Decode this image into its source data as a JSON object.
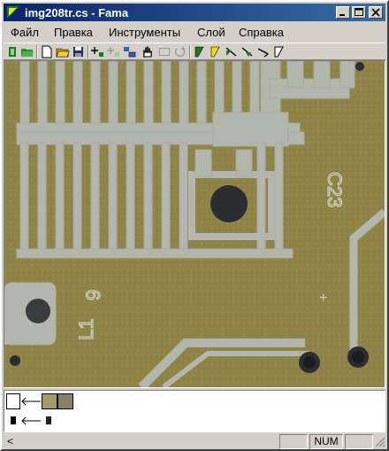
{
  "window": {
    "title": "img208tr.cs - Fama",
    "app_icon": "fama-app-icon",
    "controls": [
      "minimize-icon",
      "maximize-icon",
      "close-icon"
    ]
  },
  "menu": {
    "items": [
      {
        "label": "Файл"
      },
      {
        "label": "Правка"
      },
      {
        "label": "Инструменты"
      },
      {
        "label": "Слой"
      },
      {
        "label": "Справка"
      }
    ]
  },
  "toolbar": {
    "tools": [
      "open-layer-icon",
      "open-folder-icon",
      "new-document-icon",
      "open-file-icon",
      "save-icon",
      "add-point-icon",
      "remove-point-icon",
      "select-region-icon",
      "hand-pan-icon",
      "rect-select-icon",
      "rotate-icon",
      "layer-green-icon",
      "layer-yellow-icon",
      "layer-green-arrow-icon",
      "layer-arrow-down-icon",
      "layer-arrow-right-icon",
      "layer-outline-icon"
    ]
  },
  "canvas": {
    "image_name": "img208tr.cs",
    "silkscreen_labels": {
      "c23": "C23",
      "nine": "9",
      "l1": "L1",
      "plus": "+"
    },
    "colors": {
      "board": "#8f8348",
      "copper": "#b3b6ad",
      "copper_edge": "#a9ac9e",
      "hole": "#2c2d30"
    }
  },
  "layers": {
    "rows": [
      {
        "name": "layer-row-1",
        "swatches": [
          "#ffffff",
          "#a59a6c",
          "#8a806a"
        ]
      },
      {
        "name": "layer-row-2",
        "swatches": [
          "#000000",
          "#222222"
        ]
      }
    ]
  },
  "status": {
    "left_text": "<",
    "num": "NUM"
  }
}
